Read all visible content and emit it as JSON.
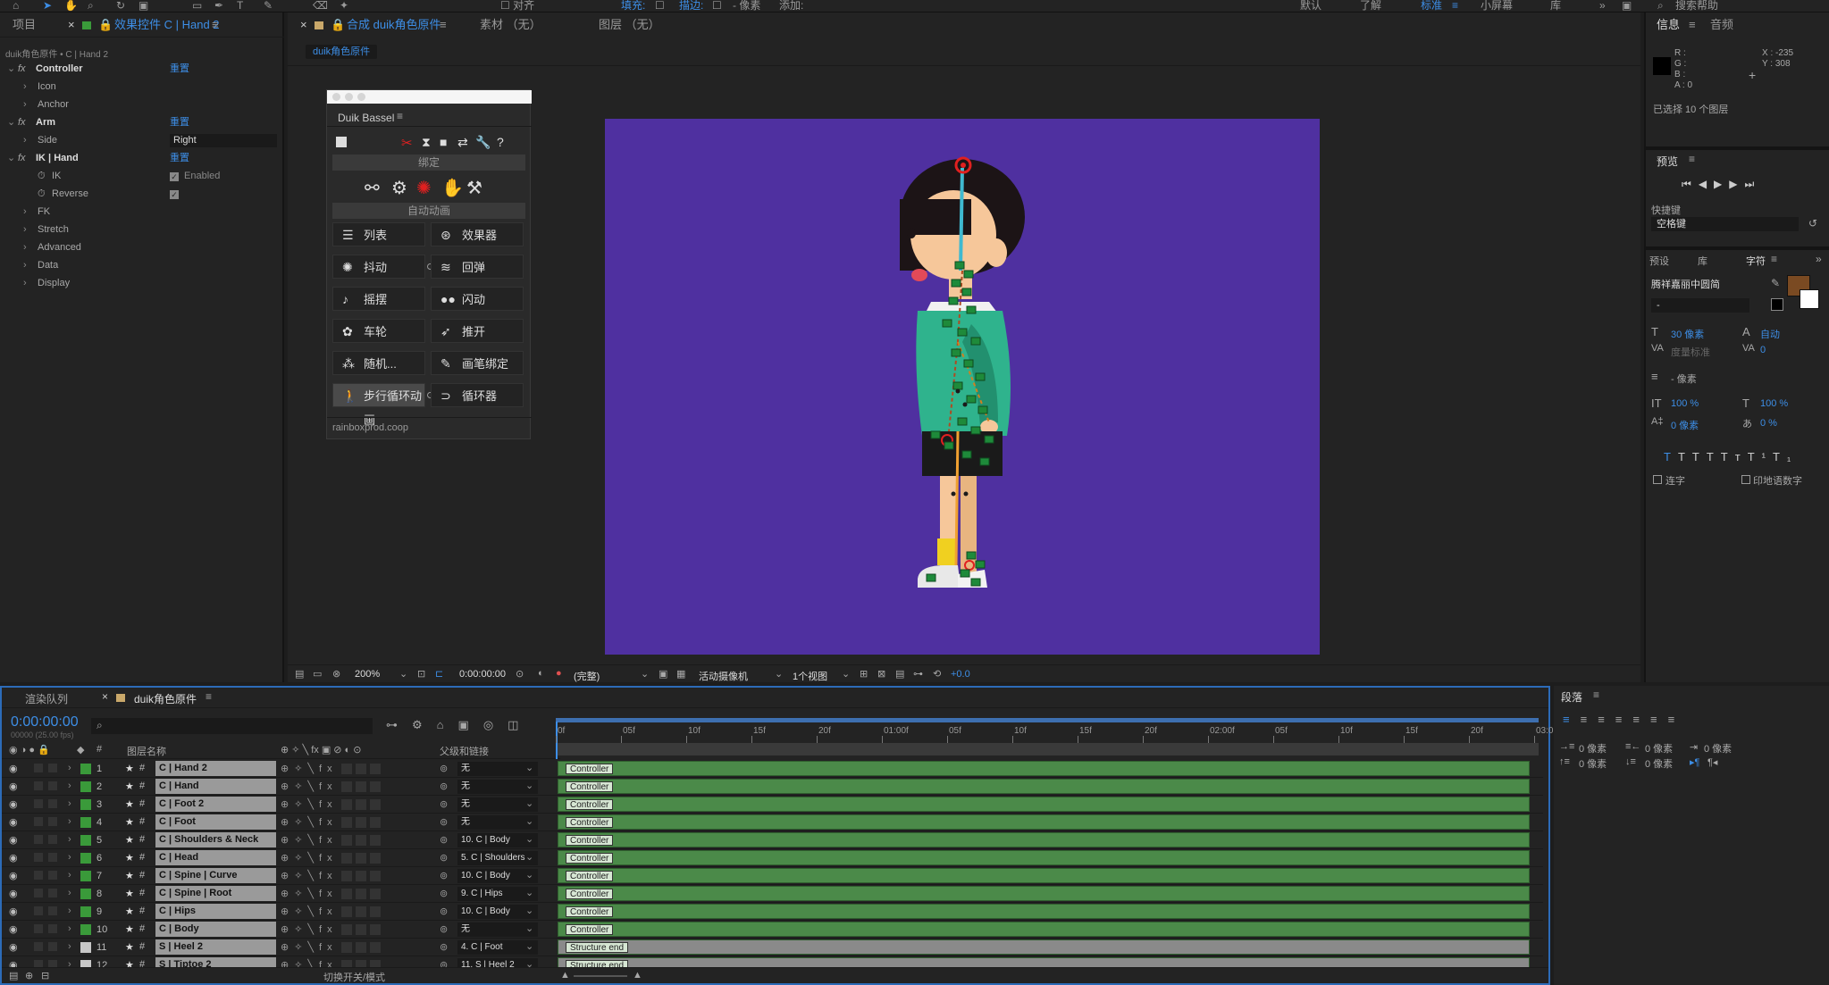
{
  "toolbar": {
    "align_label": "对齐",
    "fill_label": "填充:",
    "stroke_label": "描边:",
    "px_label": "- 像素",
    "add_label": "添加:",
    "workspaces": [
      "默认",
      "了解",
      "标准",
      "小屏幕",
      "库"
    ],
    "active_workspace": "标准",
    "search_help": "搜索帮助"
  },
  "effects_panel": {
    "tab_project": "项目",
    "tab_label": "效果控件 C | Hand 2",
    "breadcrumb": "duik角色原件 • C | Hand 2",
    "rows": [
      {
        "name": "Controller",
        "value": "重置",
        "level": 0,
        "fx": true
      },
      {
        "name": "Icon",
        "value": "",
        "level": 1,
        "fx": false
      },
      {
        "name": "Anchor",
        "value": "",
        "level": 1,
        "fx": false
      },
      {
        "name": "Arm",
        "value": "重置",
        "level": 0,
        "fx": true
      },
      {
        "name": "Side",
        "value": "Right",
        "level": 1,
        "fx": false,
        "dropdown": true
      },
      {
        "name": "IK | Hand",
        "value": "重置",
        "level": 0,
        "fx": true
      },
      {
        "name": "IK",
        "value": "Enabled",
        "level": 2,
        "fx": false,
        "checkbox": true
      },
      {
        "name": "Reverse",
        "value": "",
        "level": 2,
        "fx": false,
        "checkbox": true
      },
      {
        "name": "FK",
        "value": "",
        "level": 1,
        "fx": false
      },
      {
        "name": "Stretch",
        "value": "",
        "level": 1,
        "fx": false
      },
      {
        "name": "Advanced",
        "value": "",
        "level": 1,
        "fx": false
      },
      {
        "name": "Data",
        "value": "",
        "level": 1,
        "fx": false
      },
      {
        "name": "Display",
        "value": "",
        "level": 1,
        "fx": false
      }
    ]
  },
  "comp_panel": {
    "tab_label": "合成 duik角色原件",
    "tab_footage": "素材 （无）",
    "tab_layer": "图层 （无）",
    "sub_tab": "duik角色原件",
    "footer": {
      "zoom": "200%",
      "timecode": "0:00:00:00",
      "resolution": "(完整)",
      "camera": "活动摄像机",
      "views": "1个视图",
      "exposure": "+0.0"
    },
    "bg_color": "#4f30a0"
  },
  "duik": {
    "title": "Duik Bassel",
    "section_rig": "绑定",
    "section_anim": "自动动画",
    "buttons": [
      "列表",
      "效果器",
      "抖动",
      "回弹",
      "摇摆",
      "闪动",
      "车轮",
      "推开",
      "随机...",
      "画笔绑定",
      "步行循环动画",
      "循环器"
    ],
    "footer": "rainboxprod.coop"
  },
  "info_panel": {
    "tab_info": "信息",
    "tab_audio": "音频",
    "r": "R :",
    "g": "G :",
    "b": "B :",
    "a": "A : 0",
    "x": "X : -235",
    "y": "Y : 308",
    "selected": "已选择 10 个图层",
    "preview": "预览",
    "shortcut_label": "快捷键",
    "shortcut_value": "空格键",
    "tabs2": [
      "预设",
      "库",
      "字符"
    ],
    "font": "腾祥嘉丽中圆简",
    "font_style": "-",
    "font_size": "30 像素",
    "leading": "自动",
    "kerning": "度量标准",
    "tracking": "0",
    "stroke": "- 像素",
    "vscale": "100 %",
    "hscale": "100 %",
    "baseline": "0 像素",
    "tsume": "0 %",
    "ligatures": "连字",
    "hindi": "印地语数字",
    "swatch": "#7a4a22"
  },
  "paragraph": {
    "title": "段落",
    "indent_left": "0 像素",
    "indent_right": "0 像素",
    "indent_first": "0 像素",
    "space_before": "0 像素",
    "space_after": "0 像素"
  },
  "timeline": {
    "tab_render": "渲染队列",
    "tab_comp": "duik角色原件",
    "timecode": "0:00:00:00",
    "frame_info": "00000 (25.00 fps)",
    "col_name": "图层名称",
    "col_parent": "父级和链接",
    "footer": "切换开关/模式",
    "ruler": [
      "0f",
      "05f",
      "10f",
      "15f",
      "20f",
      "01:00f",
      "05f",
      "10f",
      "15f",
      "20f",
      "02:00f",
      "05f",
      "10f",
      "15f",
      "20f",
      "03:0"
    ],
    "layers": [
      {
        "num": "1",
        "name": "C | Hand 2",
        "parent": "无",
        "bar": "Controller",
        "color": "green"
      },
      {
        "num": "2",
        "name": "C | Hand",
        "parent": "无",
        "bar": "Controller",
        "color": "green"
      },
      {
        "num": "3",
        "name": "C | Foot 2",
        "parent": "无",
        "bar": "Controller",
        "color": "green"
      },
      {
        "num": "4",
        "name": "C | Foot",
        "parent": "无",
        "bar": "Controller",
        "color": "green"
      },
      {
        "num": "5",
        "name": "C | Shoulders & Neck",
        "parent": "10. C | Body",
        "bar": "Controller",
        "color": "green"
      },
      {
        "num": "6",
        "name": "C | Head",
        "parent": "5. C | Shoulders",
        "bar": "Controller",
        "color": "green"
      },
      {
        "num": "7",
        "name": "C | Spine | Curve",
        "parent": "10. C | Body",
        "bar": "Controller",
        "color": "green"
      },
      {
        "num": "8",
        "name": "C | Spine | Root",
        "parent": "9. C | Hips",
        "bar": "Controller",
        "color": "green"
      },
      {
        "num": "9",
        "name": "C | Hips",
        "parent": "10. C | Body",
        "bar": "Controller",
        "color": "green"
      },
      {
        "num": "10",
        "name": "C | Body",
        "parent": "无",
        "bar": "Controller",
        "color": "green"
      },
      {
        "num": "11",
        "name": "S | Heel 2",
        "parent": "4. C | Foot",
        "bar": "Structure end",
        "color": "grey"
      },
      {
        "num": "12",
        "name": "S | Tiptoe 2",
        "parent": "11. S | Heel 2",
        "bar": "Structure end",
        "color": "grey"
      }
    ]
  }
}
